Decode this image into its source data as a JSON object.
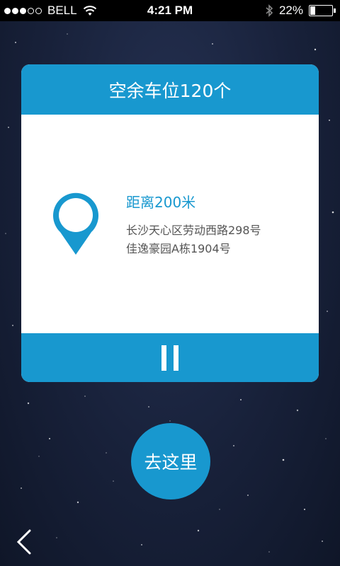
{
  "status_bar": {
    "carrier": "BELL",
    "time": "4:21 PM",
    "battery_percent": "22%",
    "battery_level": 0.22,
    "signal_strength": 3,
    "signal_max": 5,
    "icons": [
      "wifi-icon",
      "bluetooth-icon",
      "battery-icon"
    ]
  },
  "card": {
    "title": "空余车位120个",
    "distance": "距离200米",
    "address_line1": "长沙天心区劳动西路298号",
    "address_line2": "佳逸豪园A栋1904号",
    "pin_icon": "location-pin-icon",
    "footer_icon": "pause-icon"
  },
  "actions": {
    "go_label": "去这里",
    "back_icon": "back-chevron-icon"
  },
  "colors": {
    "accent": "#1898cf",
    "background": "#18213a",
    "address_text": "#555555"
  }
}
